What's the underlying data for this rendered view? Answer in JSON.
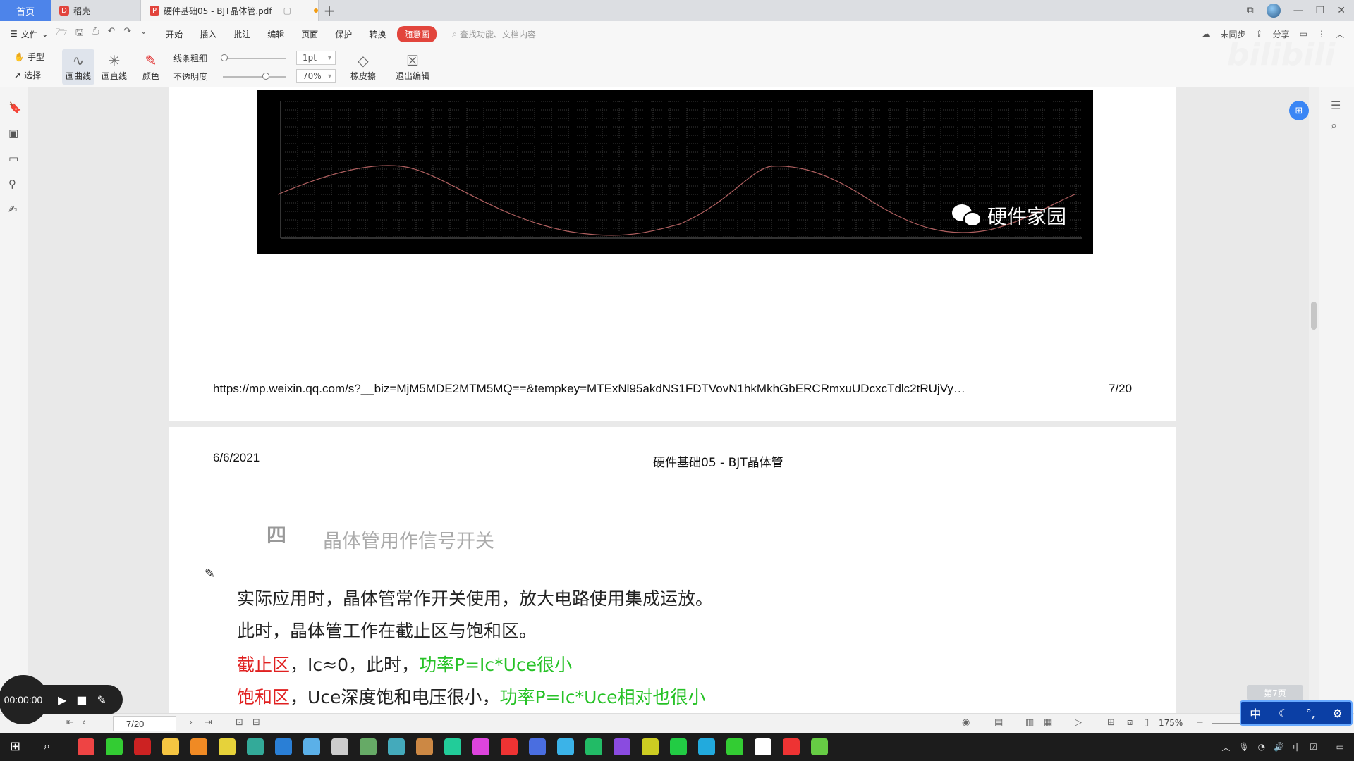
{
  "tabs": {
    "home": "首页",
    "docs": "稻壳",
    "active": "硬件基础05 - BJT晶体管.pdf",
    "add": "+"
  },
  "menu": {
    "file": "文件",
    "items": [
      "开始",
      "插入",
      "批注",
      "编辑",
      "页面",
      "保护",
      "转换"
    ],
    "highlight": "随意画",
    "search_placeholder": "查找功能、文档内容",
    "sync": "未同步",
    "share": "分享"
  },
  "drawtools": {
    "hand": "手型",
    "select": "选择",
    "curve": "画曲线",
    "line": "画直线",
    "color": "颜色",
    "thickness_label": "线条粗细",
    "opacity_label": "不透明度",
    "thickness_value": "1pt",
    "opacity_value": "70%",
    "eraser": "橡皮擦",
    "exit": "退出编辑"
  },
  "page1": {
    "watermark": "硬件家园",
    "footer_url": "https://mp.weixin.qq.com/s?__biz=MjM5MDE2MTM5MQ==&tempkey=MTExNl95akdNS1FDTVovN1hkMkhGbERCRmxuUDcxcTdlc2tRUjVyME80a0...",
    "footer_page": "7/20"
  },
  "page2": {
    "date": "6/6/2021",
    "header_title": "硬件基础05 - BJT晶体管",
    "section_number": "四",
    "section_title": "晶体管用作信号开关",
    "line1": "实际应用时，晶体管常作开关使用，放大电路使用集成运放。",
    "line2": "此时，晶体管工作在截止区与饱和区。",
    "line3_red": "截止区",
    "line3_mid": "，Ic≈0，此时，",
    "line3_green": "功率P=Ic*Uce很小",
    "line4_red": "饱和区",
    "line4_mid": "，Uce深度饱和电压很小，",
    "line4_green": "功率P=Ic*Uce相对也很小"
  },
  "statusbar": {
    "page_indicator": "7/20",
    "zoom": "175%",
    "recorder_time": "00:00:00",
    "ghost_button": "第7页"
  },
  "ime": {
    "lang": "中"
  },
  "colors": {
    "accent": "#4d84ea",
    "red": "#e02020",
    "green": "#27c227",
    "highlight_pill": "#e2453c"
  }
}
